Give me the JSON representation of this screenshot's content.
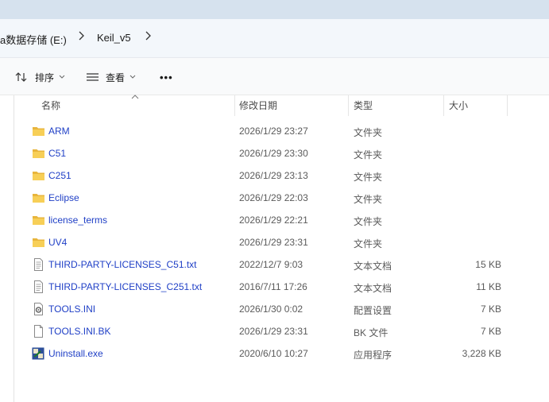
{
  "breadcrumb": {
    "items": [
      {
        "label": "a数据存储 (E:)"
      },
      {
        "label": "Keil_v5"
      }
    ]
  },
  "toolbar": {
    "sort_label": "排序",
    "view_label": "查看",
    "more_label": "•••"
  },
  "columns": {
    "name": "名称",
    "modified": "修改日期",
    "type": "类型",
    "size": "大小"
  },
  "files": [
    {
      "name": "ARM",
      "modified": "2026/1/29 23:27",
      "type": "文件夹",
      "size": "",
      "icon": "folder-icon"
    },
    {
      "name": "C51",
      "modified": "2026/1/29 23:30",
      "type": "文件夹",
      "size": "",
      "icon": "folder-icon"
    },
    {
      "name": "C251",
      "modified": "2026/1/29 23:13",
      "type": "文件夹",
      "size": "",
      "icon": "folder-icon"
    },
    {
      "name": "Eclipse",
      "modified": "2026/1/29 22:03",
      "type": "文件夹",
      "size": "",
      "icon": "folder-icon"
    },
    {
      "name": "license_terms",
      "modified": "2026/1/29 22:21",
      "type": "文件夹",
      "size": "",
      "icon": "folder-icon"
    },
    {
      "name": "UV4",
      "modified": "2026/1/29 23:31",
      "type": "文件夹",
      "size": "",
      "icon": "folder-icon"
    },
    {
      "name": "THIRD-PARTY-LICENSES_C51.txt",
      "modified": "2022/12/7 9:03",
      "type": "文本文档",
      "size": "15 KB",
      "icon": "text-file-icon"
    },
    {
      "name": "THIRD-PARTY-LICENSES_C251.txt",
      "modified": "2016/7/11 17:26",
      "type": "文本文档",
      "size": "11 KB",
      "icon": "text-file-icon"
    },
    {
      "name": "TOOLS.INI",
      "modified": "2026/1/30 0:02",
      "type": "配置设置",
      "size": "7 KB",
      "icon": "settings-file-icon"
    },
    {
      "name": "TOOLS.INI.BK",
      "modified": "2026/1/29 23:31",
      "type": "BK 文件",
      "size": "7 KB",
      "icon": "blank-file-icon"
    },
    {
      "name": "Uninstall.exe",
      "modified": "2020/6/10 10:27",
      "type": "应用程序",
      "size": "3,228 KB",
      "icon": "exe-app-icon"
    }
  ]
}
